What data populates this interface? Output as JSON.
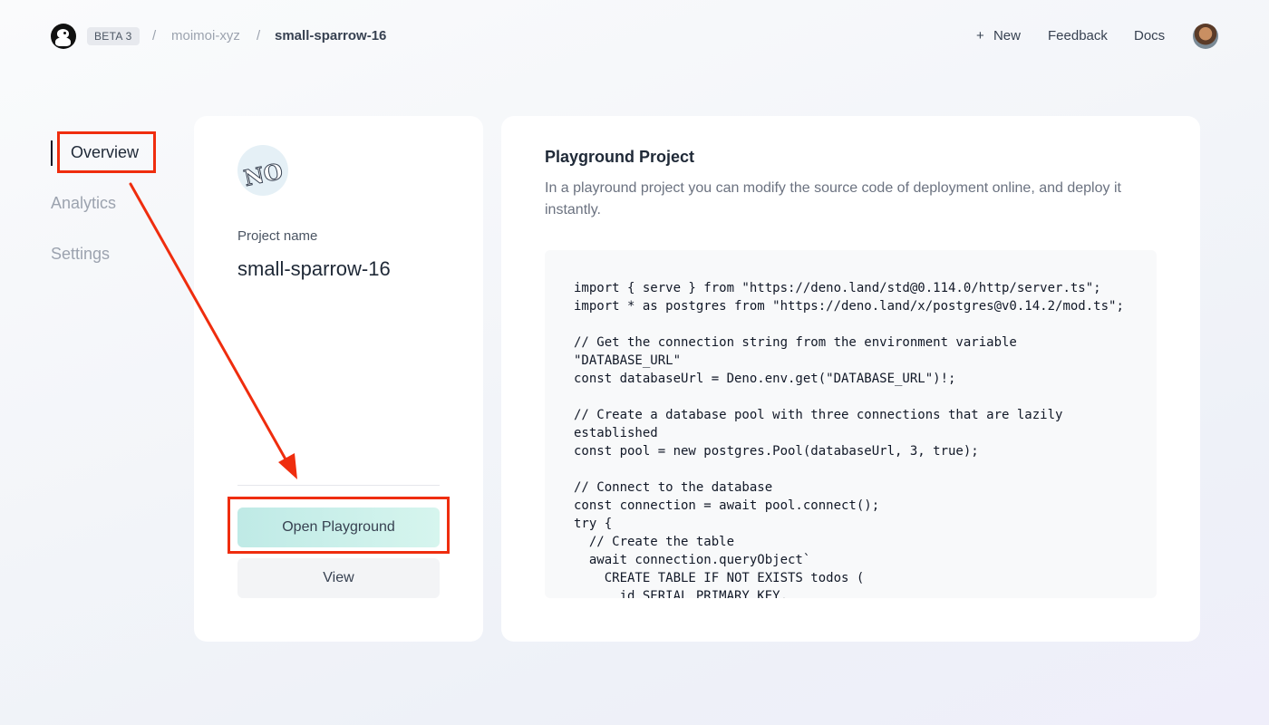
{
  "header": {
    "badge": "BETA 3",
    "breadcrumb": {
      "separator": "/",
      "org": "moimoi-xyz",
      "project": "small-sparrow-16"
    },
    "new_plus": "+",
    "new_label": "New",
    "feedback_label": "Feedback",
    "docs_label": "Docs"
  },
  "sidebar": {
    "items": [
      {
        "label": "Overview",
        "active": true
      },
      {
        "label": "Analytics",
        "active": false
      },
      {
        "label": "Settings",
        "active": false
      }
    ]
  },
  "project_card": {
    "icon_text": "NO",
    "name_label": "Project name",
    "name": "small-sparrow-16",
    "open_playground_label": "Open Playground",
    "view_label": "View"
  },
  "playground_panel": {
    "title": "Playground Project",
    "description": "In a playround project you can modify the source code of deployment online, and deploy it instantly.",
    "code": "import { serve } from \"https://deno.land/std@0.114.0/http/server.ts\";\nimport * as postgres from \"https://deno.land/x/postgres@v0.14.2/mod.ts\";\n\n// Get the connection string from the environment variable\n\"DATABASE_URL\"\nconst databaseUrl = Deno.env.get(\"DATABASE_URL\")!;\n\n// Create a database pool with three connections that are lazily\nestablished\nconst pool = new postgres.Pool(databaseUrl, 3, true);\n\n// Connect to the database\nconst connection = await pool.connect();\ntry {\n  // Create the table\n  await connection.queryObject`\n    CREATE TABLE IF NOT EXISTS todos (\n      id SERIAL PRIMARY KEY,"
  },
  "colors": {
    "annotation": "#ef2d0e",
    "playground_button": "#c9efea",
    "view_button": "#f3f4f6"
  }
}
